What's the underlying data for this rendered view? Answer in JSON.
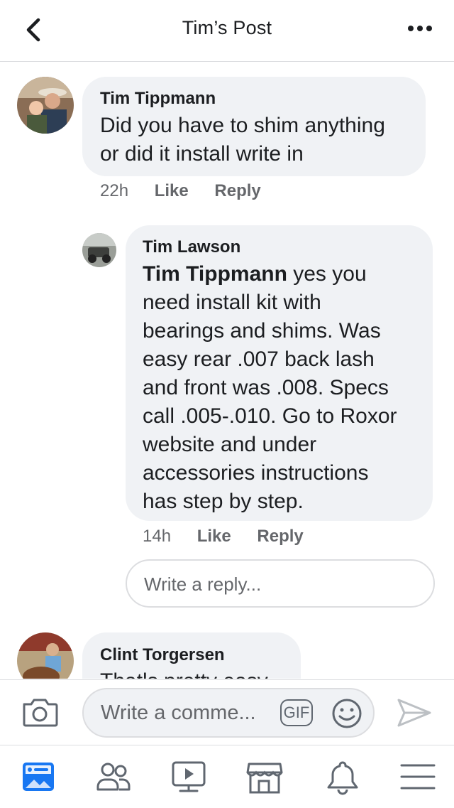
{
  "header": {
    "title": "Tim’s Post"
  },
  "comments": [
    {
      "author": "Tim Tippmann",
      "lines": [
        "Did you have to shim anything",
        "or did it install write in"
      ],
      "time": "22h",
      "like_label": "Like",
      "reply_label": "Reply"
    },
    {
      "author": "Tim Lawson",
      "mention": "Tim Tippmann",
      "first_line_rest": " yes you",
      "lines": [
        "need install kit with",
        "bearings and shims. Was",
        "easy rear .007 back lash",
        "and front was .008. Specs",
        "call .005-.010. Go to Roxor",
        "website and under",
        "accessories instructions",
        "has step by step."
      ],
      "time": "14h",
      "like_label": "Like",
      "reply_label": "Reply"
    },
    {
      "author": "Clint Torgersen",
      "partial_line": "Thatls pretty easy"
    }
  ],
  "reply_box": {
    "placeholder": "Write a reply..."
  },
  "composer": {
    "placeholder": "Write a comme...",
    "gif_label": "GIF"
  },
  "tabs": [
    {
      "icon": "news-feed-icon",
      "active": true
    },
    {
      "icon": "friends-icon"
    },
    {
      "icon": "watch-icon"
    },
    {
      "icon": "marketplace-icon"
    },
    {
      "icon": "notifications-icon"
    },
    {
      "icon": "menu-icon"
    }
  ],
  "colors": {
    "accent": "#1877f2",
    "bubble": "#f0f2f5",
    "secondary_text": "#65676b",
    "icon_gray": "#606770"
  }
}
